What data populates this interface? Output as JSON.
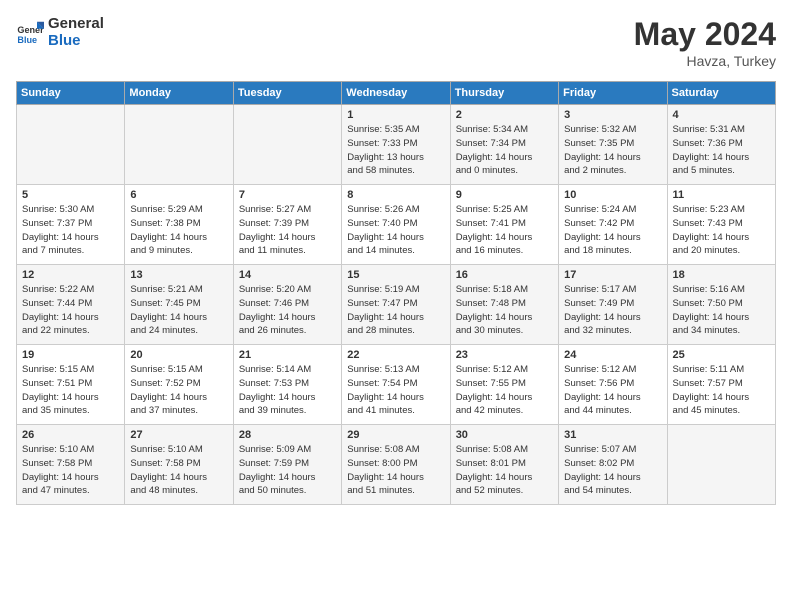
{
  "header": {
    "logo_general": "General",
    "logo_blue": "Blue",
    "month_year": "May 2024",
    "location": "Havza, Turkey"
  },
  "days_of_week": [
    "Sunday",
    "Monday",
    "Tuesday",
    "Wednesday",
    "Thursday",
    "Friday",
    "Saturday"
  ],
  "weeks": [
    [
      {
        "day": "",
        "info": ""
      },
      {
        "day": "",
        "info": ""
      },
      {
        "day": "",
        "info": ""
      },
      {
        "day": "1",
        "info": "Sunrise: 5:35 AM\nSunset: 7:33 PM\nDaylight: 13 hours\nand 58 minutes."
      },
      {
        "day": "2",
        "info": "Sunrise: 5:34 AM\nSunset: 7:34 PM\nDaylight: 14 hours\nand 0 minutes."
      },
      {
        "day": "3",
        "info": "Sunrise: 5:32 AM\nSunset: 7:35 PM\nDaylight: 14 hours\nand 2 minutes."
      },
      {
        "day": "4",
        "info": "Sunrise: 5:31 AM\nSunset: 7:36 PM\nDaylight: 14 hours\nand 5 minutes."
      }
    ],
    [
      {
        "day": "5",
        "info": "Sunrise: 5:30 AM\nSunset: 7:37 PM\nDaylight: 14 hours\nand 7 minutes."
      },
      {
        "day": "6",
        "info": "Sunrise: 5:29 AM\nSunset: 7:38 PM\nDaylight: 14 hours\nand 9 minutes."
      },
      {
        "day": "7",
        "info": "Sunrise: 5:27 AM\nSunset: 7:39 PM\nDaylight: 14 hours\nand 11 minutes."
      },
      {
        "day": "8",
        "info": "Sunrise: 5:26 AM\nSunset: 7:40 PM\nDaylight: 14 hours\nand 14 minutes."
      },
      {
        "day": "9",
        "info": "Sunrise: 5:25 AM\nSunset: 7:41 PM\nDaylight: 14 hours\nand 16 minutes."
      },
      {
        "day": "10",
        "info": "Sunrise: 5:24 AM\nSunset: 7:42 PM\nDaylight: 14 hours\nand 18 minutes."
      },
      {
        "day": "11",
        "info": "Sunrise: 5:23 AM\nSunset: 7:43 PM\nDaylight: 14 hours\nand 20 minutes."
      }
    ],
    [
      {
        "day": "12",
        "info": "Sunrise: 5:22 AM\nSunset: 7:44 PM\nDaylight: 14 hours\nand 22 minutes."
      },
      {
        "day": "13",
        "info": "Sunrise: 5:21 AM\nSunset: 7:45 PM\nDaylight: 14 hours\nand 24 minutes."
      },
      {
        "day": "14",
        "info": "Sunrise: 5:20 AM\nSunset: 7:46 PM\nDaylight: 14 hours\nand 26 minutes."
      },
      {
        "day": "15",
        "info": "Sunrise: 5:19 AM\nSunset: 7:47 PM\nDaylight: 14 hours\nand 28 minutes."
      },
      {
        "day": "16",
        "info": "Sunrise: 5:18 AM\nSunset: 7:48 PM\nDaylight: 14 hours\nand 30 minutes."
      },
      {
        "day": "17",
        "info": "Sunrise: 5:17 AM\nSunset: 7:49 PM\nDaylight: 14 hours\nand 32 minutes."
      },
      {
        "day": "18",
        "info": "Sunrise: 5:16 AM\nSunset: 7:50 PM\nDaylight: 14 hours\nand 34 minutes."
      }
    ],
    [
      {
        "day": "19",
        "info": "Sunrise: 5:15 AM\nSunset: 7:51 PM\nDaylight: 14 hours\nand 35 minutes."
      },
      {
        "day": "20",
        "info": "Sunrise: 5:15 AM\nSunset: 7:52 PM\nDaylight: 14 hours\nand 37 minutes."
      },
      {
        "day": "21",
        "info": "Sunrise: 5:14 AM\nSunset: 7:53 PM\nDaylight: 14 hours\nand 39 minutes."
      },
      {
        "day": "22",
        "info": "Sunrise: 5:13 AM\nSunset: 7:54 PM\nDaylight: 14 hours\nand 41 minutes."
      },
      {
        "day": "23",
        "info": "Sunrise: 5:12 AM\nSunset: 7:55 PM\nDaylight: 14 hours\nand 42 minutes."
      },
      {
        "day": "24",
        "info": "Sunrise: 5:12 AM\nSunset: 7:56 PM\nDaylight: 14 hours\nand 44 minutes."
      },
      {
        "day": "25",
        "info": "Sunrise: 5:11 AM\nSunset: 7:57 PM\nDaylight: 14 hours\nand 45 minutes."
      }
    ],
    [
      {
        "day": "26",
        "info": "Sunrise: 5:10 AM\nSunset: 7:58 PM\nDaylight: 14 hours\nand 47 minutes."
      },
      {
        "day": "27",
        "info": "Sunrise: 5:10 AM\nSunset: 7:58 PM\nDaylight: 14 hours\nand 48 minutes."
      },
      {
        "day": "28",
        "info": "Sunrise: 5:09 AM\nSunset: 7:59 PM\nDaylight: 14 hours\nand 50 minutes."
      },
      {
        "day": "29",
        "info": "Sunrise: 5:08 AM\nSunset: 8:00 PM\nDaylight: 14 hours\nand 51 minutes."
      },
      {
        "day": "30",
        "info": "Sunrise: 5:08 AM\nSunset: 8:01 PM\nDaylight: 14 hours\nand 52 minutes."
      },
      {
        "day": "31",
        "info": "Sunrise: 5:07 AM\nSunset: 8:02 PM\nDaylight: 14 hours\nand 54 minutes."
      },
      {
        "day": "",
        "info": ""
      }
    ]
  ]
}
